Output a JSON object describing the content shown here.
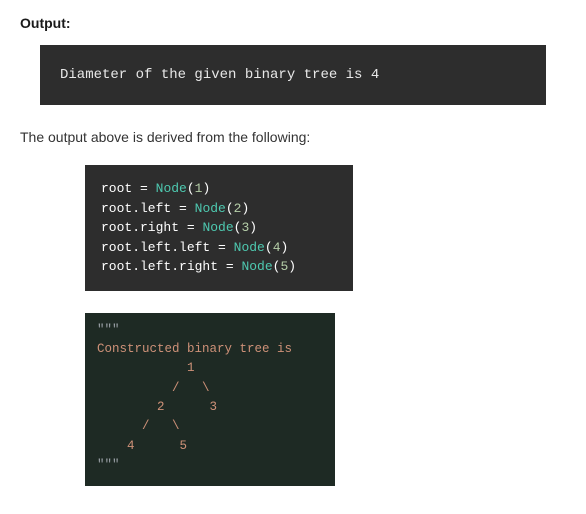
{
  "section_title": "Output:",
  "output_text": "Diameter of the given binary tree is 4",
  "explain_text": "The output above is derived from the following:",
  "code1": {
    "l1": {
      "a": "root ",
      "op": "=",
      "sp": " ",
      "cls": "Node",
      "p1": "(",
      "num": "1",
      "p2": ")"
    },
    "l2": {
      "a": "root.left ",
      "op": "=",
      "sp": " ",
      "cls": "Node",
      "p1": "(",
      "num": "2",
      "p2": ")"
    },
    "l3": {
      "a": "root.right ",
      "op": "=",
      "sp": " ",
      "cls": "Node",
      "p1": "(",
      "num": "3",
      "p2": ")"
    },
    "l4": {
      "a": "root.left.left ",
      "op": "=",
      "sp": " ",
      "cls": "Node",
      "p1": "(",
      "num": "4",
      "p2": ")"
    },
    "l5": {
      "a": "root.left.right ",
      "op": "=",
      "sp": " ",
      "cls": "Node",
      "p1": "(",
      "num": "5",
      "p2": ")"
    }
  },
  "code2": {
    "q1": "\"\"\"",
    "l1": "Constructed binary tree is",
    "l2": "            1",
    "l3": "          /   \\",
    "l4": "        2      3",
    "l5": "      /   \\",
    "l6": "    4      5",
    "q2": "\"\"\""
  }
}
